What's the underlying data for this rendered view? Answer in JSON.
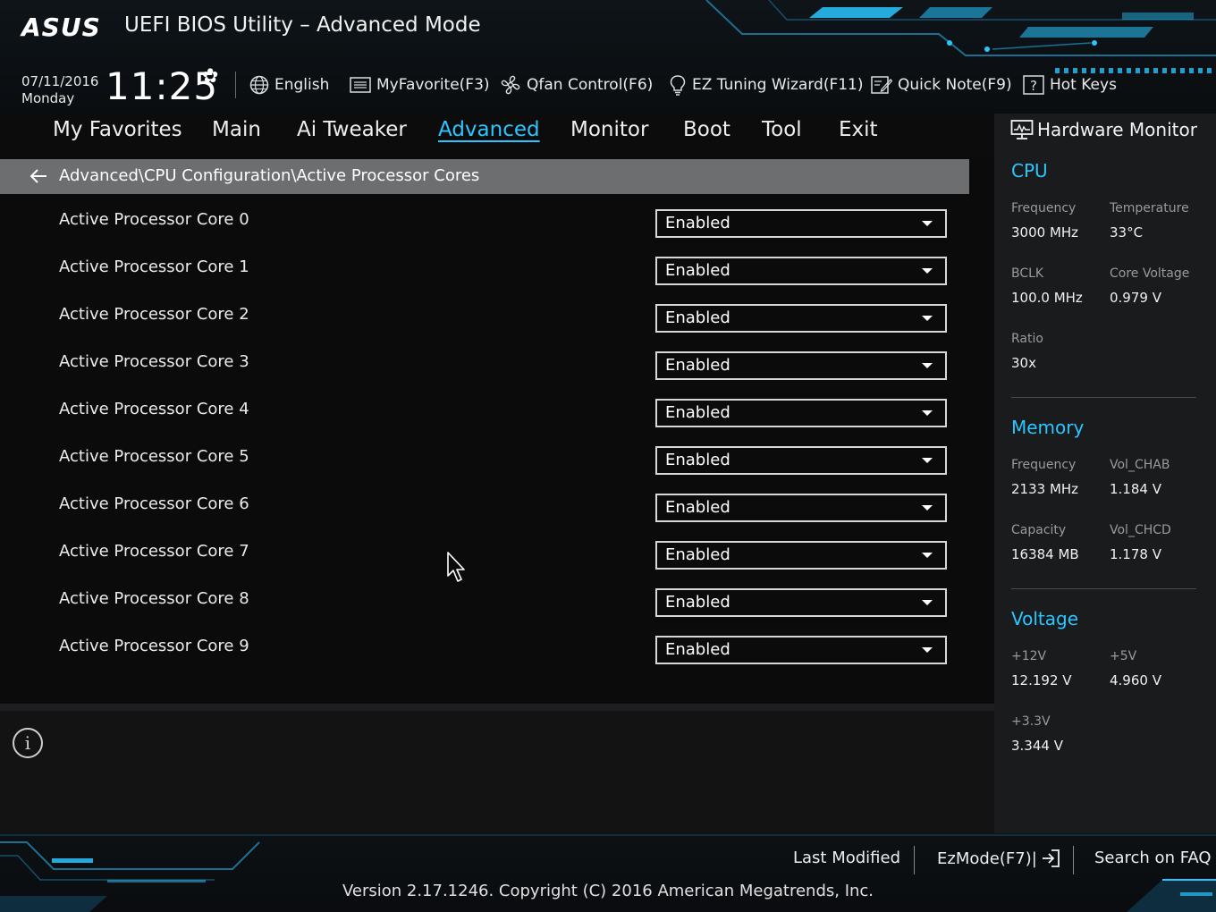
{
  "header": {
    "logo": "ASUS",
    "title": "UEFI BIOS Utility – Advanced Mode",
    "date": "07/11/2016",
    "day": "Monday",
    "time": "11:25",
    "toolbar": {
      "language": "English",
      "myfavorite": "MyFavorite(F3)",
      "qfan": "Qfan Control(F6)",
      "ez_tuning": "EZ Tuning Wizard(F11)",
      "quick_note": "Quick Note(F9)",
      "hot_keys": "Hot Keys"
    }
  },
  "nav": {
    "items": [
      "My Favorites",
      "Main",
      "Ai Tweaker",
      "Advanced",
      "Monitor",
      "Boot",
      "Tool",
      "Exit"
    ],
    "active": "Advanced"
  },
  "breadcrumb": "Advanced\\CPU Configuration\\Active Processor Cores",
  "settings": [
    {
      "label": "Active Processor Core 0",
      "value": "Enabled"
    },
    {
      "label": "Active Processor Core 1",
      "value": "Enabled"
    },
    {
      "label": "Active Processor Core 2",
      "value": "Enabled"
    },
    {
      "label": "Active Processor Core 3",
      "value": "Enabled"
    },
    {
      "label": "Active Processor Core 4",
      "value": "Enabled"
    },
    {
      "label": "Active Processor Core 5",
      "value": "Enabled"
    },
    {
      "label": "Active Processor Core 6",
      "value": "Enabled"
    },
    {
      "label": "Active Processor Core 7",
      "value": "Enabled"
    },
    {
      "label": "Active Processor Core 8",
      "value": "Enabled"
    },
    {
      "label": "Active Processor Core 9",
      "value": "Enabled"
    }
  ],
  "hardware_monitor": {
    "title": "Hardware Monitor",
    "cpu": {
      "title": "CPU",
      "frequency_label": "Frequency",
      "frequency": "3000 MHz",
      "temperature_label": "Temperature",
      "temperature": "33°C",
      "bclk_label": "BCLK",
      "bclk": "100.0 MHz",
      "core_voltage_label": "Core Voltage",
      "core_voltage": "0.979 V",
      "ratio_label": "Ratio",
      "ratio": "30x"
    },
    "memory": {
      "title": "Memory",
      "frequency_label": "Frequency",
      "frequency": "2133 MHz",
      "vol_chab_label": "Vol_CHAB",
      "vol_chab": "1.184 V",
      "capacity_label": "Capacity",
      "capacity": "16384 MB",
      "vol_chcd_label": "Vol_CHCD",
      "vol_chcd": "1.178 V"
    },
    "voltage": {
      "title": "Voltage",
      "v12_label": "+12V",
      "v12": "12.192 V",
      "v5_label": "+5V",
      "v5": "4.960 V",
      "v33_label": "+3.3V",
      "v33": "3.344 V"
    }
  },
  "footer": {
    "last_modified": "Last Modified",
    "ezmode": "EzMode(F7)|",
    "search_faq": "Search on FAQ",
    "copyright": "Version 2.17.1246. Copyright (C) 2016 American Megatrends, Inc."
  },
  "colors": {
    "accent": "#2bc6ff",
    "background": "#0b0b0c",
    "breadcrumb_bg": "#6d6e70",
    "sidebar_bg": "#1a1b1d"
  }
}
